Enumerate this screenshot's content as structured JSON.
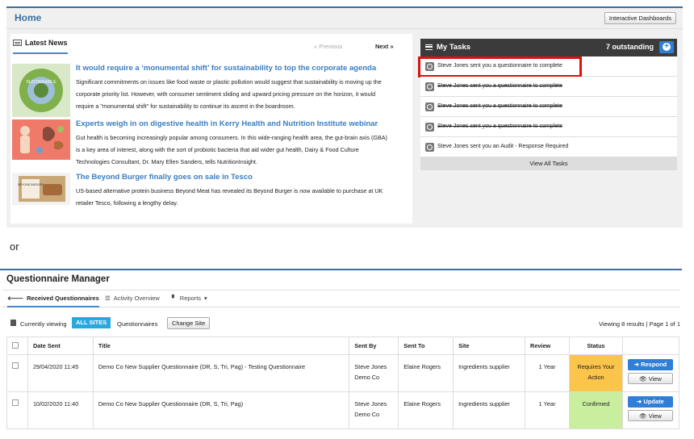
{
  "home": {
    "title": "Home",
    "dashboards_button": "Interactive Dashboards"
  },
  "news": {
    "heading": "Latest News",
    "prev_label": "« Previous",
    "next_label": "Next »",
    "items": [
      {
        "title": "It would require a ‘monumental shift’ for sustainability to top the corporate agenda",
        "body": "Significant commitments on issues like food waste or plastic pollution would suggest that sustainability is moving up the corporate priority list. However, with consumer sentiment sliding and upward pricing pressure on the horizon, it would require a \"monumental shift\" for sustainability to continue its ascent in the boardroom.",
        "thumb_text": "SUSTAINABLE"
      },
      {
        "title": "Experts weigh in on digestive health in Kerry Health and Nutrition Institute webinar",
        "body": "Gut health is becoming increasingly popular among consumers. In this wide-ranging health area, the gut-brain axis (GBA) is a key area of interest, along with the sort of probiotic bacteria that aid wider gut health, Dairy & Food Culture Technologies Consultant, Dr. Mary Ellen Sanders, tells NutritionInsight."
      },
      {
        "title": "The Beyond Burger finally goes on sale in Tesco",
        "body": "US-based alternative protein business Beyond Meat has revealed its Beyond Burger is now available to purchase at UK retailer Tesco, following a lengthy delay.",
        "thumb_text": "BEYOND BURGER"
      }
    ]
  },
  "tasks": {
    "heading": "My Tasks",
    "count_label": "7 outstanding",
    "add_symbol": "+",
    "items": [
      {
        "text": "Steve Jones sent you a questionnaire to complete",
        "struck": false
      },
      {
        "text": "Steve Jones sent you a questionnaire to complete",
        "struck": true
      },
      {
        "text": "Steve Jones sent you a questionnaire to complete",
        "struck": true
      },
      {
        "text": "Steve Jones sent you a questionnaire to complete",
        "struck": true
      },
      {
        "text": "Steve Jones sent you an Audit - Response Required",
        "struck": false
      }
    ],
    "view_all": "View All Tasks"
  },
  "separator_text": "or",
  "qm": {
    "title": "Questionnaire Manager",
    "tabs": {
      "received": "Received Questionnaires",
      "activity": "Activity Overview",
      "reports": "Reports"
    },
    "viewbar": {
      "currently_viewing": "Currently viewing",
      "all_sites": "ALL SITES",
      "questionnaires": "Questionnaires",
      "change_site": "Change Site",
      "results": "Viewing 8 results | Page 1 of 1"
    },
    "columns": [
      "Date Sent",
      "Title",
      "Sent By",
      "Sent To",
      "Site",
      "Review",
      "Status"
    ],
    "rows": [
      {
        "date": "29/04/2020 11:45",
        "title": "Demo Co New Supplier Questionnaire (DR, S, Tri, Pag) - Testing Questionnaire",
        "sent_by_name": "Steve Jones",
        "sent_by_company": "Demo Co",
        "sent_to": "Elaine Rogers",
        "site": "Ingredients supplier",
        "review": "1 Year",
        "status_line1": "Requires Your",
        "status_line2": "Action",
        "status_color": "#fbc44a",
        "primary_action": "Respond",
        "secondary_action": "View"
      },
      {
        "date": "10/02/2020 11:40",
        "title": "Demo Co New Supplier Questionnaire (DR, S, Tri, Pag)",
        "sent_by_name": "Steve Jones",
        "sent_by_company": "Demo Co",
        "sent_to": "Elaine Rogers",
        "site": "Ingredients supplier",
        "review": "1 Year",
        "status_line1": "Confirmed",
        "status_line2": "",
        "status_color": "#c9ee9e",
        "primary_action": "Update",
        "secondary_action": "View"
      }
    ]
  }
}
